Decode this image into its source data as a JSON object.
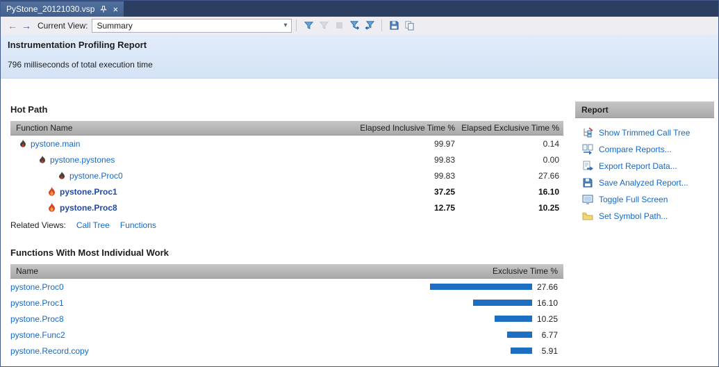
{
  "tab": {
    "title": "PyStone_20121030.vsp",
    "close_glyph": "×"
  },
  "toolbar": {
    "back_glyph": "←",
    "forward_glyph": "→",
    "current_view_label": "Current View:",
    "view_dropdown_value": "Summary",
    "chevron_glyph": "▾",
    "icons": [
      "filter-icon",
      "filter-disabled-icon",
      "stop-icon",
      "filter-in-icon",
      "filter-out-icon",
      "save-icon",
      "copy-icon"
    ]
  },
  "header": {
    "title": "Instrumentation Profiling Report",
    "subtitle": "796 milliseconds of total execution time"
  },
  "hot_path": {
    "title": "Hot Path",
    "columns": [
      "Function Name",
      "Elapsed Inclusive Time %",
      "Elapsed Exclusive Time %"
    ],
    "rows": [
      {
        "name": "pystone.main",
        "inclusive": "99.97",
        "exclusive": "0.14",
        "hot": false
      },
      {
        "name": "pystone.pystones",
        "inclusive": "99.83",
        "exclusive": "0.00",
        "hot": false
      },
      {
        "name": "pystone.Proc0",
        "inclusive": "99.83",
        "exclusive": "27.66",
        "hot": false
      },
      {
        "name": "pystone.Proc1",
        "inclusive": "37.25",
        "exclusive": "16.10",
        "hot": true
      },
      {
        "name": "pystone.Proc8",
        "inclusive": "12.75",
        "exclusive": "10.25",
        "hot": true
      }
    ],
    "related_views_label": "Related Views:",
    "related_links": [
      "Call Tree",
      "Functions"
    ]
  },
  "functions_work": {
    "title": "Functions With Most Individual Work",
    "columns": [
      "Name",
      "Exclusive Time %"
    ],
    "rows": [
      {
        "name": "pystone.Proc0",
        "value_text": "27.66"
      },
      {
        "name": "pystone.Proc1",
        "value_text": "16.10"
      },
      {
        "name": "pystone.Proc8",
        "value_text": "10.25"
      },
      {
        "name": "pystone.Func2",
        "value_text": "6.77"
      },
      {
        "name": "pystone.Record.copy",
        "value_text": "5.91"
      }
    ]
  },
  "chart_data": {
    "type": "bar",
    "categories": [
      "pystone.Proc0",
      "pystone.Proc1",
      "pystone.Proc8",
      "pystone.Func2",
      "pystone.Record.copy"
    ],
    "values": [
      27.66,
      16.1,
      10.25,
      6.77,
      5.91
    ],
    "title": "Functions With Most Individual Work",
    "xlabel": "Exclusive Time %",
    "ylabel": "",
    "xlim": [
      0,
      30
    ],
    "legend": "none",
    "grid": false
  },
  "report_panel": {
    "title": "Report",
    "items": [
      {
        "label": "Show Trimmed Call Tree",
        "icon": "trimmed-call-tree-icon"
      },
      {
        "label": "Compare Reports...",
        "icon": "compare-reports-icon"
      },
      {
        "label": "Export Report Data...",
        "icon": "export-report-data-icon"
      },
      {
        "label": "Save Analyzed Report...",
        "icon": "save-analyzed-report-icon"
      },
      {
        "label": "Toggle Full Screen",
        "icon": "toggle-full-screen-icon"
      },
      {
        "label": "Set Symbol Path...",
        "icon": "set-symbol-path-icon"
      }
    ]
  },
  "colors": {
    "tab_blue": "#46648f",
    "titlebar_navy": "#2c3f63",
    "band_blue": "#dcebfa",
    "link_blue": "#1569c7",
    "hot_navy": "#1d49a8",
    "bar_blue": "#1b6ec2",
    "flame_red": "#d6452c",
    "header_gray": "#b7b7b7"
  }
}
